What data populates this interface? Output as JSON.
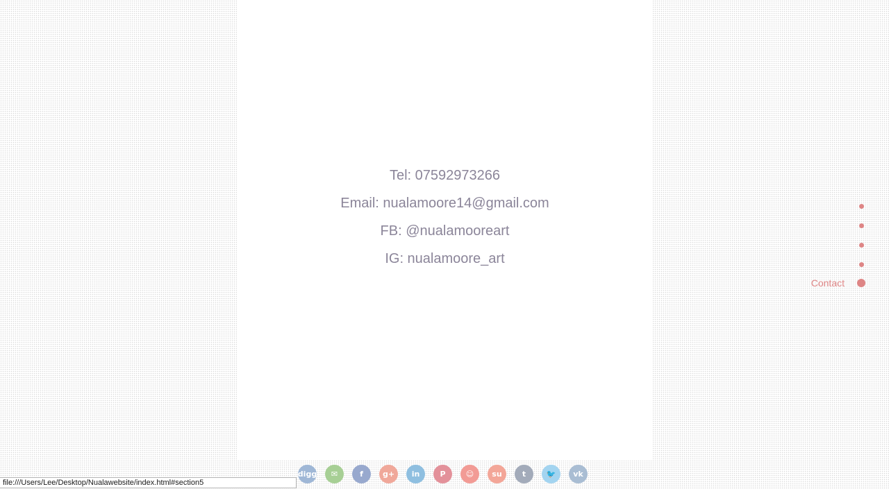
{
  "contact": {
    "tel": "Tel: 07592973266",
    "email": "Email: nualamoore14@gmail.com",
    "fb": "FB: @nualamooreart",
    "ig": "IG: nualamoore_art"
  },
  "side_nav": {
    "items": [
      {
        "label": ""
      },
      {
        "label": ""
      },
      {
        "label": ""
      },
      {
        "label": ""
      },
      {
        "label": "Contact",
        "active": true
      }
    ],
    "accent_color": "#de8585"
  },
  "share_buttons": [
    {
      "name": "digg-icon",
      "glyph": "digg",
      "color": "#9fb7d6"
    },
    {
      "name": "email-icon",
      "glyph": "✉",
      "color": "#a7cf95"
    },
    {
      "name": "facebook-icon",
      "glyph": "f",
      "color": "#98a9ce"
    },
    {
      "name": "google-plus-icon",
      "glyph": "g+",
      "color": "#f0a89a"
    },
    {
      "name": "linkedin-icon",
      "glyph": "in",
      "color": "#8fbfe0"
    },
    {
      "name": "pinterest-icon",
      "glyph": "P",
      "color": "#e3919a"
    },
    {
      "name": "reddit-icon",
      "glyph": "☺",
      "color": "#f29b95"
    },
    {
      "name": "stumbleupon-icon",
      "glyph": "su",
      "color": "#f3a698"
    },
    {
      "name": "tumblr-icon",
      "glyph": "t",
      "color": "#a3abba"
    },
    {
      "name": "twitter-icon",
      "glyph": "🐦",
      "color": "#a3d4f0"
    },
    {
      "name": "vk-icon",
      "glyph": "vk",
      "color": "#a9bdd3"
    }
  ],
  "status_bar": {
    "url": "file:///Users/Lee/Desktop/Nualawebsite/index.html#section5"
  }
}
